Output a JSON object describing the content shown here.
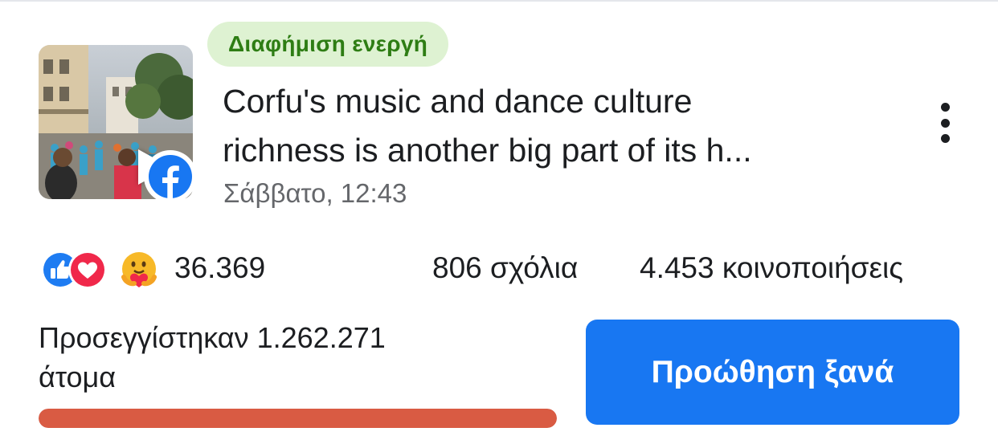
{
  "ad": {
    "status_label": "Διαφήμιση ενεργή",
    "title_line1": "Corfu's music and dance culture",
    "title_line2": "richness is another big part of its h...",
    "date": "Σάββατο, 12:43",
    "thumbnail_icon": "play-icon",
    "platform_icon": "facebook-icon"
  },
  "stats": {
    "reaction_icons": [
      "like-icon",
      "love-icon",
      "care-icon"
    ],
    "reaction_count": "36.369",
    "comments": "806 σχόλια",
    "shares": "4.453 κοινοποιήσεις"
  },
  "reach": {
    "line1": "Προσεγγίστηκαν 1.262.271",
    "line2": "άτομα",
    "progress_fraction": 1.0
  },
  "actions": {
    "boost_label": "Προώθηση ξανά"
  },
  "colors": {
    "status_bg": "#def2d2",
    "status_text": "#2e7d14",
    "primary": "#1877f2",
    "progress": "#d95b43"
  }
}
